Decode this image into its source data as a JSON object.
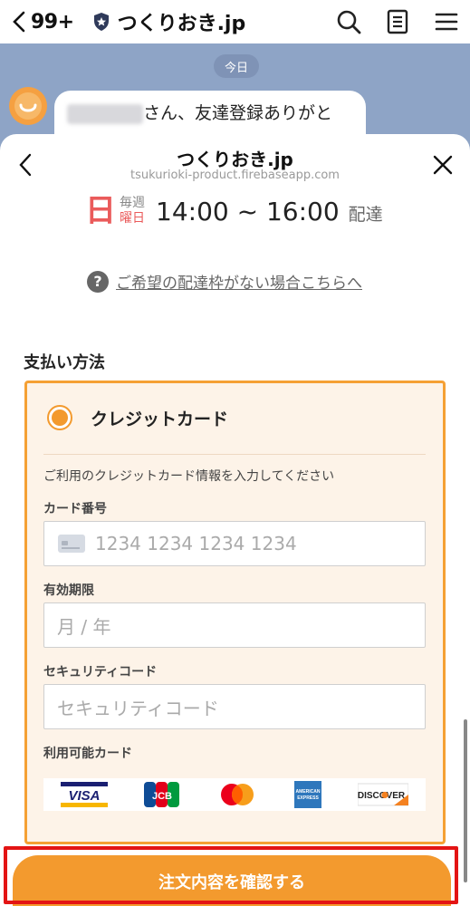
{
  "line_header": {
    "unread_count": "99+",
    "title": "つくりおき.jp"
  },
  "chat": {
    "date": "今日",
    "message_suffix": "さん、友達登録ありがと"
  },
  "sheet": {
    "title": "つくりおき.jp",
    "url": "tsukurioki-product.firebaseapp.com",
    "delivery": {
      "day": "日",
      "weekly": "毎週",
      "weekday": "曜日",
      "time": "14:00 ~ 16:00",
      "label": "配達"
    },
    "help_link": "ご希望の配達枠がない場合こちらへ",
    "payment": {
      "heading": "支払い方法",
      "method": "クレジットカード",
      "description": "ご利用のクレジットカード情報を入力してください",
      "card_number_label": "カード番号",
      "card_number_placeholder": "1234 1234 1234 1234",
      "expiry_label": "有効期限",
      "expiry_placeholder": "月 / 年",
      "cvc_label": "セキュリティコード",
      "cvc_placeholder": "セキュリティコード",
      "brands_label": "利用可能カード",
      "brands": [
        "VISA",
        "JCB",
        "Mastercard",
        "AMERICAN EXPRESS",
        "DISCOVER"
      ]
    },
    "confirm_button": "注文内容を確認する"
  },
  "colors": {
    "accent": "#f39a2e",
    "highlight": "#e31414",
    "sunday": "#ea5b5b"
  }
}
